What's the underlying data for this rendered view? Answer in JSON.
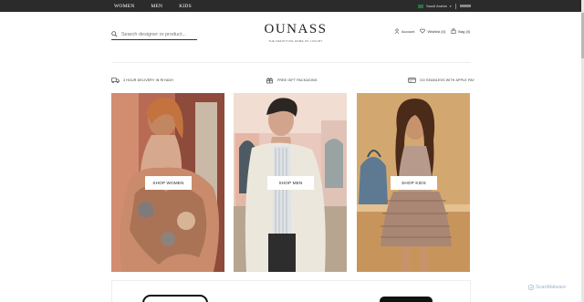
{
  "topbar": {
    "nav": [
      "WOMEN",
      "MEN",
      "KIDS"
    ],
    "country": "Saudi Arabia"
  },
  "header": {
    "search_placeholder": "Search designer or product...",
    "logo": "OUNASS",
    "tagline": "THE DEFINITIVE HOME OF LUXURY",
    "account_label": "Account",
    "wishlist_label": "Wishlist (0)",
    "bag_label": "Bag (0)"
  },
  "features": [
    {
      "icon": "truck-icon",
      "label": "3 HOUR DELIVERY IN RIYADH"
    },
    {
      "icon": "gift-icon",
      "label": "FREE GIFT PACKAGING"
    },
    {
      "icon": "card-icon",
      "label": "GO SEAMLESS WITH APPLE PAY"
    }
  ],
  "cards": [
    {
      "label": "SHOP WOMEN"
    },
    {
      "label": "SHOP MEN"
    },
    {
      "label": "SHOP KIDS"
    }
  ],
  "watermark": "ScanMalware",
  "colors": {
    "topbar": "#2b2b2b",
    "text": "#222222",
    "flag": "#1f7a3a"
  }
}
